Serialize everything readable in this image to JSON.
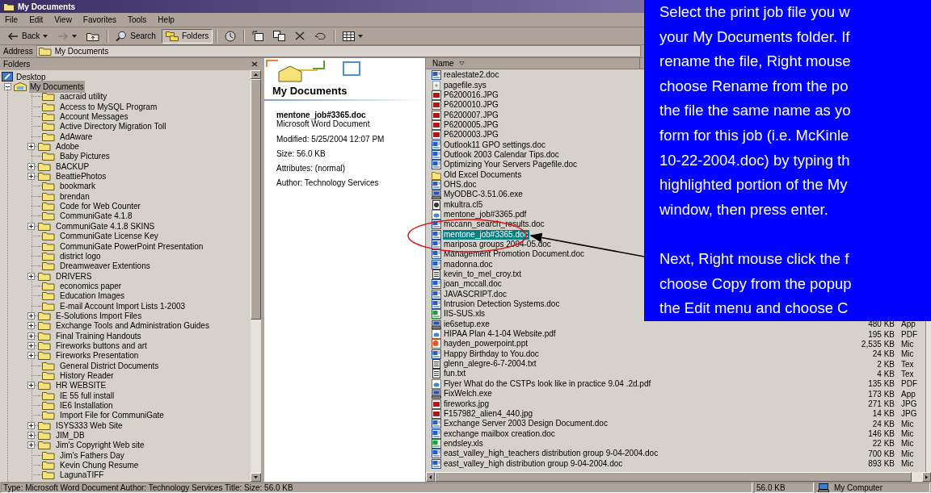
{
  "window": {
    "title": "My Documents"
  },
  "menu": [
    "File",
    "Edit",
    "View",
    "Favorites",
    "Tools",
    "Help"
  ],
  "toolbar": [
    {
      "kind": "back",
      "label": "Back",
      "pressed": false,
      "disabled": false
    },
    {
      "kind": "forward",
      "pressed": false,
      "disabled": true
    },
    {
      "kind": "up",
      "pressed": false,
      "disabled": false
    },
    {
      "kind": "search",
      "label": "Search",
      "pressed": false,
      "disabled": false
    },
    {
      "kind": "folders",
      "label": "Folders",
      "pressed": true,
      "disabled": false
    },
    {
      "kind": "history",
      "pressed": false,
      "disabled": false
    },
    {
      "kind": "move",
      "pressed": false,
      "disabled": false
    },
    {
      "kind": "copy",
      "pressed": false,
      "disabled": false
    },
    {
      "kind": "delete",
      "pressed": false,
      "disabled": false
    },
    {
      "kind": "undo",
      "pressed": false,
      "disabled": false
    },
    {
      "kind": "views",
      "pressed": false,
      "disabled": false
    }
  ],
  "address": {
    "label": "Address",
    "value": "My Documents"
  },
  "folders": {
    "title": "Folders",
    "tree": [
      {
        "label": "Desktop",
        "selected": false,
        "children": [
          {
            "label": "My Documents",
            "selected": true,
            "expanded": true,
            "children": [
              {
                "label": "aacraid utility",
                "has_children": false,
                "selected": false
              },
              {
                "label": "Access to MySQL Program",
                "has_children": false,
                "selected": false
              },
              {
                "label": "Account Messages",
                "has_children": false,
                "selected": false
              },
              {
                "label": "Active Directory Migration Toll",
                "has_children": false,
                "selected": false
              },
              {
                "label": "AdAware",
                "has_children": false,
                "selected": false
              },
              {
                "label": "Adobe",
                "has_children": true,
                "selected": false
              },
              {
                "label": "Baby Pictures",
                "has_children": false,
                "selected": false
              },
              {
                "label": "BACKUP",
                "has_children": true,
                "selected": false
              },
              {
                "label": "BeattiePhotos",
                "has_children": true,
                "selected": false
              },
              {
                "label": "bookmark",
                "has_children": false,
                "selected": false
              },
              {
                "label": "brendan",
                "has_children": false,
                "selected": false
              },
              {
                "label": "Code for Web Counter",
                "has_children": false,
                "selected": false
              },
              {
                "label": "CommuniGate 4.1.8",
                "has_children": false,
                "selected": false
              },
              {
                "label": "CommuniGate 4.1.8 SKINS",
                "has_children": true,
                "selected": false
              },
              {
                "label": "CommuniGate License Key",
                "has_children": false,
                "selected": false
              },
              {
                "label": "CommuniGate PowerPoint Presentation",
                "has_children": false,
                "selected": false
              },
              {
                "label": "district logo",
                "has_children": false,
                "selected": false
              },
              {
                "label": "Dreamweaver Extentions",
                "has_children": false,
                "selected": false
              },
              {
                "label": "DRIVERS",
                "has_children": true,
                "selected": false
              },
              {
                "label": "economics paper",
                "has_children": false,
                "selected": false
              },
              {
                "label": "Education Images",
                "has_children": false,
                "selected": false
              },
              {
                "label": "E-mail Account Import Lists 1-2003",
                "has_children": false,
                "selected": false
              },
              {
                "label": "E-Solutions Import Files",
                "has_children": true,
                "selected": false
              },
              {
                "label": "Exchange Tools and Administration Guides",
                "has_children": true,
                "selected": false
              },
              {
                "label": "Final Training Handouts",
                "has_children": true,
                "selected": false
              },
              {
                "label": "Fireworks buttons and art",
                "has_children": true,
                "selected": false
              },
              {
                "label": "Fireworks Presentation",
                "has_children": true,
                "selected": false
              },
              {
                "label": "General District Documents",
                "has_children": false,
                "selected": false
              },
              {
                "label": "History Reader",
                "has_children": false,
                "selected": false
              },
              {
                "label": "HR WEBSITE",
                "has_children": true,
                "selected": false
              },
              {
                "label": "IE 55 full install",
                "has_children": false,
                "selected": false
              },
              {
                "label": "IE6 Installation",
                "has_children": false,
                "selected": false
              },
              {
                "label": "Import File for CommuniGate",
                "has_children": false,
                "selected": false
              },
              {
                "label": "ISYS333 Web Site",
                "has_children": true,
                "selected": false
              },
              {
                "label": "JIM_DB",
                "has_children": true,
                "selected": false
              },
              {
                "label": "Jim's Copyright Web site",
                "has_children": true,
                "selected": false
              },
              {
                "label": "Jim's Fathers Day",
                "has_children": false,
                "selected": false
              },
              {
                "label": "Kevin Chung Resume",
                "has_children": false,
                "selected": false
              },
              {
                "label": "LagunaTIFF",
                "has_children": false,
                "selected": false
              }
            ]
          }
        ]
      }
    ]
  },
  "details": {
    "title": "My Documents",
    "file_name": "mentone_job#3365.doc",
    "file_type": "Microsoft Word Document",
    "fields": [
      "Modified: 5/25/2004 12:07 PM",
      "Size: 56.0 KB",
      "Attributes: (normal)",
      "Author: Technology Services"
    ]
  },
  "files": {
    "column": "Name",
    "rows": [
      {
        "name": "realestate2.doc",
        "kind": "doc",
        "selected": false
      },
      {
        "name": "pagefile.sys",
        "kind": "sys",
        "selected": false
      },
      {
        "name": "P6200016.JPG",
        "kind": "jpg",
        "selected": false
      },
      {
        "name": "P6200010.JPG",
        "kind": "jpg",
        "selected": false
      },
      {
        "name": "P6200007.JPG",
        "kind": "jpg",
        "selected": false
      },
      {
        "name": "P6200005.JPG",
        "kind": "jpg",
        "selected": false
      },
      {
        "name": "P6200003.JPG",
        "kind": "jpg",
        "selected": false
      },
      {
        "name": "Outlook11 GPO settings.doc",
        "kind": "doc",
        "selected": false
      },
      {
        "name": "Outlook 2003 Calendar Tips.doc",
        "kind": "doc",
        "selected": false
      },
      {
        "name": "Optimizing Your Servers Pagefile.doc",
        "kind": "doc",
        "selected": false
      },
      {
        "name": "Old Excel Documents",
        "kind": "folder",
        "selected": false
      },
      {
        "name": "OHS.doc",
        "kind": "doc",
        "selected": false
      },
      {
        "name": "MyODBC-3.51.06.exe",
        "kind": "exe",
        "selected": false
      },
      {
        "name": "mkultra.cl5",
        "kind": "other",
        "selected": false
      },
      {
        "name": "mentone_job#3365.pdf",
        "kind": "pdf",
        "selected": false
      },
      {
        "name": "mccann_search_results.doc",
        "kind": "doc",
        "selected": false
      },
      {
        "name": "mentone_job#3365.doc",
        "kind": "doc",
        "selected": true
      },
      {
        "name": "mariposa groups 2004-05.doc",
        "kind": "doc",
        "selected": false
      },
      {
        "name": "Management Promotion Document.doc",
        "kind": "doc",
        "selected": false
      },
      {
        "name": "madonna.doc",
        "kind": "doc",
        "selected": false
      },
      {
        "name": "kevin_to_mel_croy.txt",
        "kind": "txt",
        "selected": false
      },
      {
        "name": "joan_mccall.doc",
        "kind": "doc",
        "selected": false
      },
      {
        "name": "JAVASCRIPT.doc",
        "kind": "doc",
        "selected": false
      },
      {
        "name": "Intrusion Detection Systems.doc",
        "kind": "doc",
        "selected": false
      },
      {
        "name": "IIS-SUS.xls",
        "kind": "xls",
        "selected": false
      },
      {
        "name": "ie6setup.exe",
        "kind": "exe",
        "selected": false,
        "size": "480 KB",
        "type": "App"
      },
      {
        "name": "HIPAA Plan 4-1-04 Website.pdf",
        "kind": "pdf",
        "selected": false,
        "size": "195 KB",
        "type": "PDF"
      },
      {
        "name": "hayden_powerpoint.ppt",
        "kind": "ppt",
        "selected": false,
        "size": "2,535 KB",
        "type": "Mic"
      },
      {
        "name": "Happy Birthday to You.doc",
        "kind": "doc",
        "selected": false,
        "size": "24 KB",
        "type": "Mic"
      },
      {
        "name": "glenn_alegre-6-7-2004.txt",
        "kind": "txt",
        "selected": false,
        "size": "2 KB",
        "type": "Tex"
      },
      {
        "name": "fun.txt",
        "kind": "txt",
        "selected": false,
        "size": "4 KB",
        "type": "Tex"
      },
      {
        "name": "Flyer What do the CSTPs look like in practice 9.04 .2d.pdf",
        "kind": "pdf",
        "selected": false,
        "size": "135 KB",
        "type": "PDF"
      },
      {
        "name": "FixWelch.exe",
        "kind": "exe",
        "selected": false,
        "size": "173 KB",
        "type": "App"
      },
      {
        "name": "fireworks.jpg",
        "kind": "jpg",
        "selected": false,
        "size": "271 KB",
        "type": "JPG"
      },
      {
        "name": "F157982_alien4_440.jpg",
        "kind": "jpg",
        "selected": false,
        "size": "14 KB",
        "type": "JPG"
      },
      {
        "name": "Exchange Server 2003 Design Document.doc",
        "kind": "doc",
        "selected": false,
        "size": "24 KB",
        "type": "Mic"
      },
      {
        "name": "exchange mailbox creation.doc",
        "kind": "doc",
        "selected": false,
        "size": "146 KB",
        "type": "Mic"
      },
      {
        "name": "endsley.xls",
        "kind": "xls",
        "selected": false,
        "size": "22 KB",
        "type": "Mic"
      },
      {
        "name": "east_valley_high_teachers distribution group 9-04-2004.doc",
        "kind": "doc",
        "selected": false,
        "size": "700 KB",
        "type": "Mic"
      },
      {
        "name": "east_valley_high distribution group 9-04-2004.doc",
        "kind": "doc",
        "selected": false,
        "size": "893 KB",
        "type": "Mic"
      }
    ]
  },
  "status_bar": [
    "Type: Microsoft Word Document Author: Technology Services Title: Size: 56.0 KB",
    "56.0 KB",
    "My Computer"
  ],
  "callout": {
    "paragraphs": [
      [
        "Select the print job file you w",
        "your My Documents folder. If",
        "rename the file, Right mouse",
        "choose Rename from the po",
        "the file the same name as yo",
        "form for this job (i.e. McKinle",
        "10-22-2004.doc) by typing th",
        "highlighted portion of the My",
        "window, then press enter."
      ],
      [
        "Next, Right mouse click the f",
        "choose Copy from the popup",
        "the Edit menu and choose C"
      ]
    ]
  }
}
